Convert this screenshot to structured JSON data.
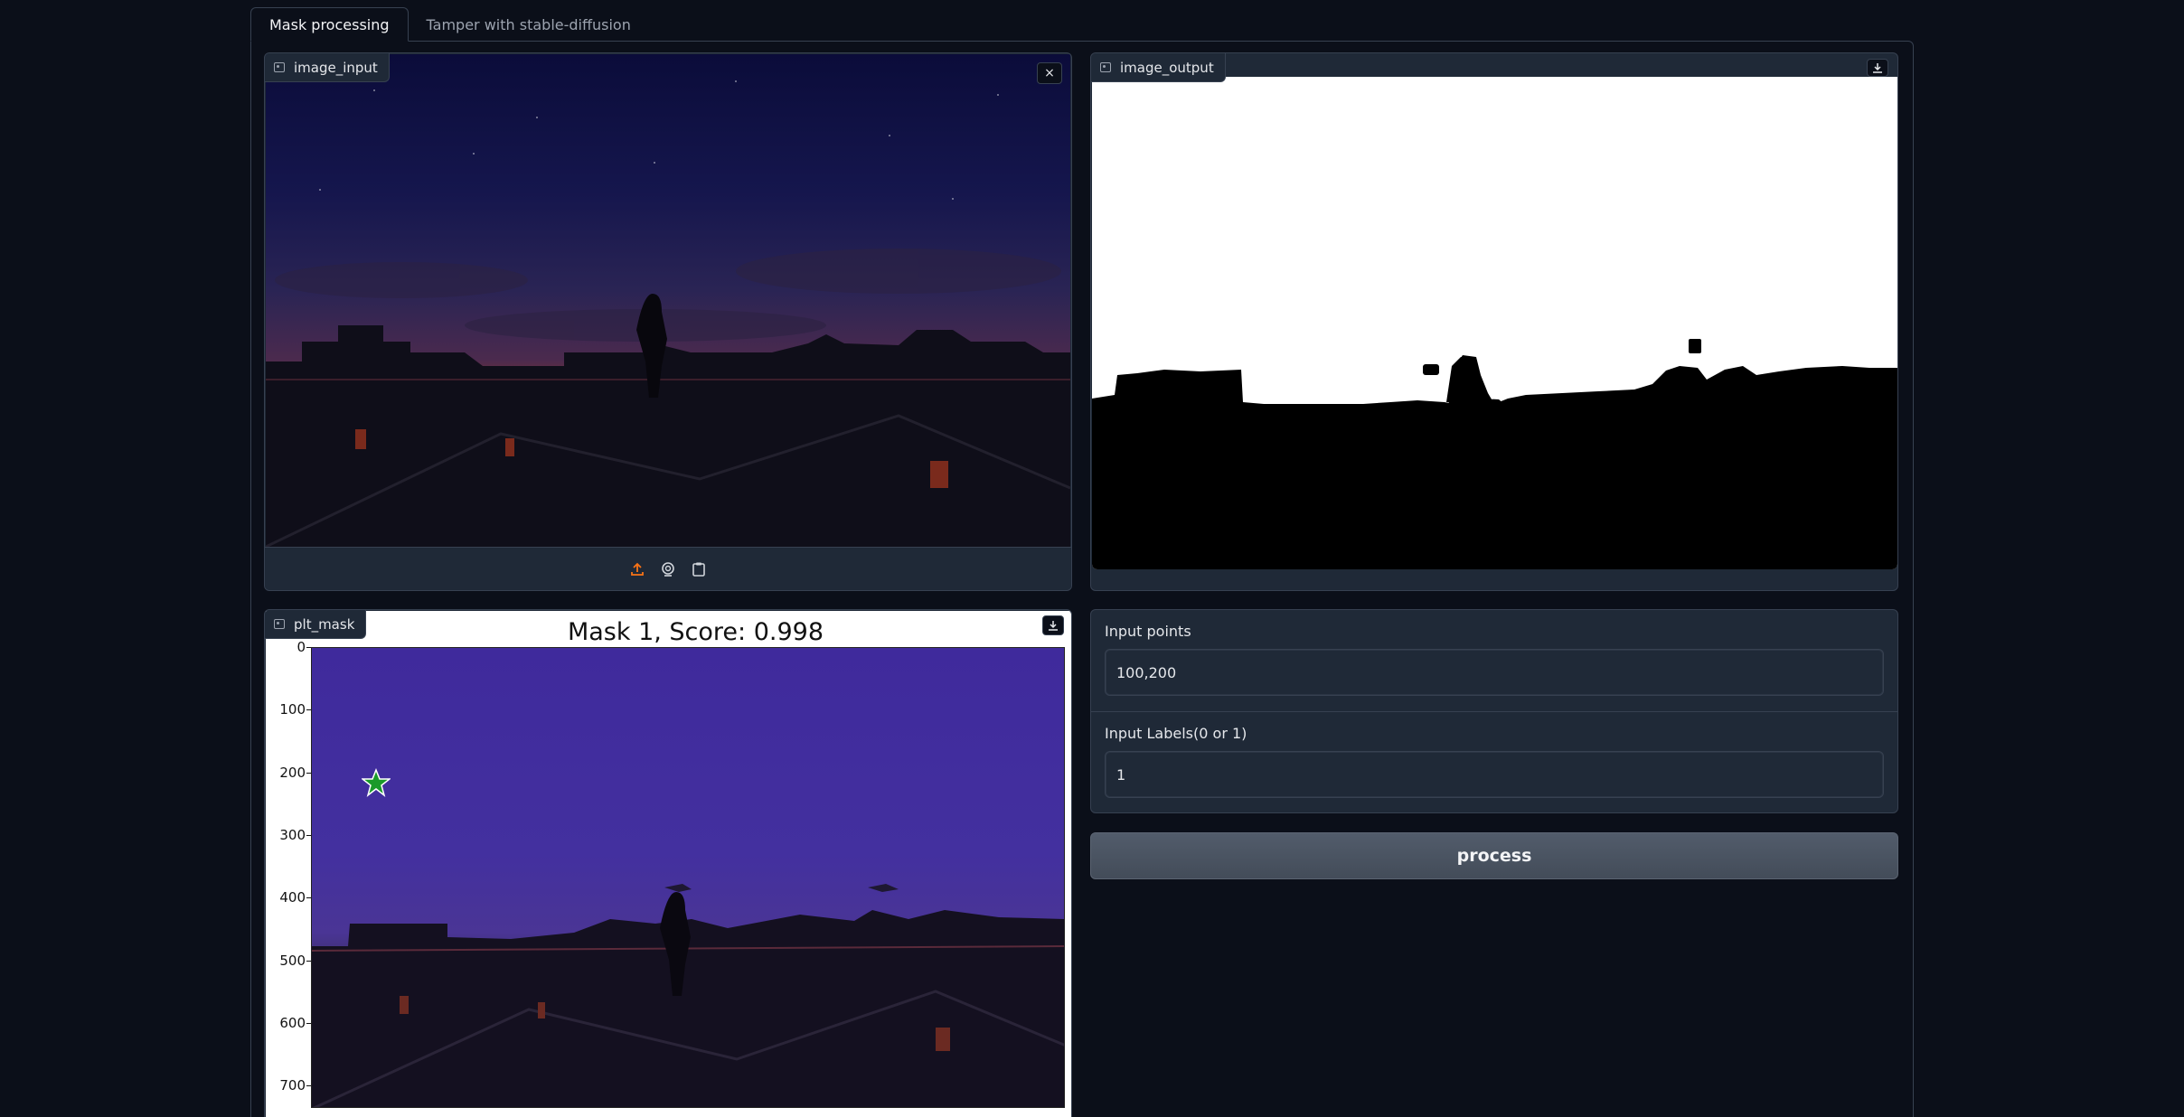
{
  "tabs": [
    {
      "label": "Mask processing"
    },
    {
      "label": "Tamper with stable-diffusion"
    }
  ],
  "image_input": {
    "label": "image_input",
    "close_icon": "×"
  },
  "image_output": {
    "label": "image_output"
  },
  "plt_mask": {
    "label": "plt_mask",
    "title": "Mask 1, Score: 0.998",
    "yticks": [
      "0",
      "100",
      "200",
      "300",
      "400",
      "500",
      "600",
      "700"
    ]
  },
  "form": {
    "points_label": "Input points",
    "points_value": "100,200",
    "labels_label": "Input Labels(0 or 1)",
    "labels_value": "1"
  },
  "process_label": "process",
  "colors": {
    "background": "#0b0f19",
    "panel": "#1f2937",
    "border": "#374151",
    "accent": "#f97316"
  }
}
